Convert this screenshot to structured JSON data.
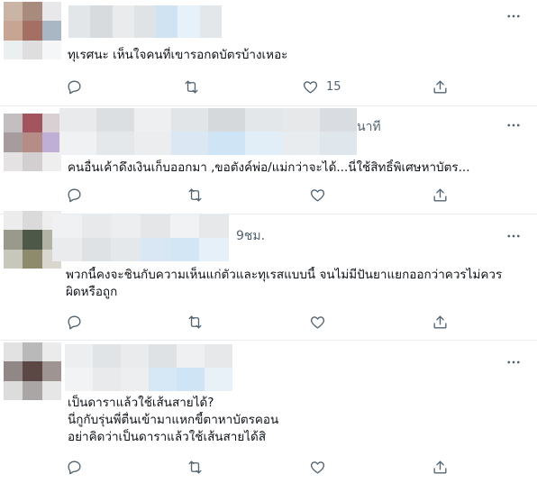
{
  "tweets": [
    {
      "timestamp": "",
      "lines": [
        "ทุเรศนะ เห็นใจคนที่เขารอกดบัตรบ้างเหอะ"
      ],
      "like_count": "15"
    },
    {
      "timestamp": "นาที",
      "lines": [
        "คนอื่นเค้าดึงเงินเก็บออกมา ,ขอตังค์พ่อ/แม่กว่าจะได้...นี่ใช้สิทธิ์พิเศษหาบัตร..."
      ],
      "like_count": ""
    },
    {
      "timestamp": "9ชม.",
      "lines": [
        "พวกนี้คงจะชินกับความเห็นแก่ตัวและทุเรสแบบนี้  จนไม่มีปันยาแยกออกว่าควรไม่ควร",
        "ผิดหรือถูก"
      ],
      "like_count": ""
    },
    {
      "timestamp": "",
      "lines": [
        "เป็นดาราแล้วใช้เส้นสายได้?",
        "นี่กูกับรุ่นพี่ตื่นเข้ามาแหกขี้ตาหาบัตรคอน",
        "อย่าคิดว่าเป็นดาราแล้วใช้เส้นสายได้สิ"
      ],
      "like_count": ""
    }
  ],
  "icons": {
    "more": "more-icon",
    "reply": "reply-icon",
    "retweet": "retweet-icon",
    "like": "like-icon",
    "share": "share-icon"
  },
  "colors": {
    "text": "#0f1419",
    "muted": "#536471",
    "divider": "#e7ecf0"
  }
}
